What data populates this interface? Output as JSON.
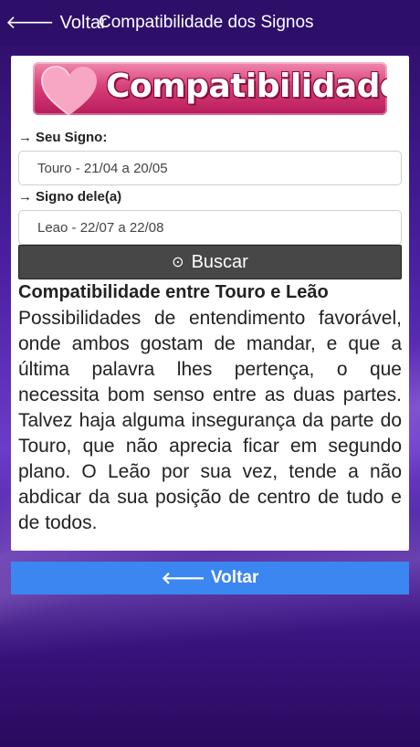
{
  "topbar": {
    "back_label": "Voltar",
    "title": "Compatibilidade dos Signos"
  },
  "banner": {
    "text": "Compatibilidade",
    "icon": "heart-icon"
  },
  "form": {
    "seu_signo_label": "Seu Signo:",
    "seu_signo_value": "Touro - 21/04 a 20/05",
    "signo_dele_label": "Signo dele(a)",
    "signo_dele_value": "Leao - 22/07 a 22/08",
    "buscar_label": "Buscar",
    "arrow": "→"
  },
  "result": {
    "title": "Compatibilidade entre Touro e Leão",
    "text": "Possibilidades de entendimento favorável, onde ambos gostam de mandar, e que a última palavra lhes pertença, o que necessita bom senso entre as duas partes. Talvez haja alguma insegurança da parte do Touro, que não aprecia ficar em segundo plano. O Leão por sua vez, tende a não abdicar da sua posição de centro de tudo e de todos."
  },
  "footer": {
    "back_label": "Voltar"
  },
  "colors": {
    "topbar": "#2d0f6a",
    "accent_blue": "#3b86f0",
    "button_dark": "#474747",
    "banner_pink": "#d8407a"
  }
}
